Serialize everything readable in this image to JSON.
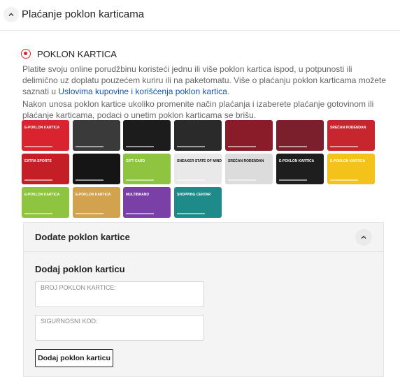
{
  "section": {
    "title": "Plaćanje poklon karticama",
    "toggle_icon": "chevron-up-icon"
  },
  "payment_option": {
    "label": "POKLON KARTICA",
    "selected": true,
    "accent_color": "#e0232d"
  },
  "description": {
    "paragraph1_text": "Platite svoju online porudžbinu koristeći jednu ili više poklon kartica ispod, u potpunosti ili delimično uz doplatu pouzećem kuriru ili na paketomatu. Više o plaćanju poklon karticama možete saznati u ",
    "paragraph1_link": "Uslovima kupovine i korišćenja poklon kartica",
    "paragraph1_end": ".",
    "paragraph2": "Nakon unosa poklon kartice ukoliko promenite način plaćanja i izaberete plaćanje gotovinom ili plaćanje karticama, podaci o unetim poklon karticama se brišu.",
    "link_color": "#1a55a6"
  },
  "gift_cards": [
    {
      "name": "card-e-poklon-red",
      "text": "E-POKLON KARTICA",
      "bg": "#d9232e"
    },
    {
      "name": "card-dark-promo",
      "text": "",
      "bg": "#3a3a3a"
    },
    {
      "name": "card-play-the-game",
      "text": "",
      "bg": "#1c1c1c"
    },
    {
      "name": "card-football",
      "text": "",
      "bg": "#2a2a2a"
    },
    {
      "name": "card-fitness",
      "text": "",
      "bg": "#8a1c2a"
    },
    {
      "name": "card-basketball",
      "text": "",
      "bg": "#7a1f2b"
    },
    {
      "name": "card-srecan-rodjendan-red",
      "text": "SREĆAN ROĐENDAN",
      "bg": "#c8262f"
    },
    {
      "name": "card-extra-sports",
      "text": "EXTRA SPORTS",
      "bg": "#c41f27"
    },
    {
      "name": "card-black-yellow",
      "text": "",
      "bg": "#151515"
    },
    {
      "name": "card-gift-card-green",
      "text": "GIFT CARD",
      "bg": "#8ec43f"
    },
    {
      "name": "card-sneaker-state",
      "text": "SNEAKER STATE OF MIND",
      "bg": "#e9e9e9"
    },
    {
      "name": "card-srecan-rodjendan-bw",
      "text": "SREĆAN ROĐENDAN",
      "bg": "#dcdcdc"
    },
    {
      "name": "card-e-poklon-black",
      "text": "E-POKLON KARTICA",
      "bg": "#1e1e1e"
    },
    {
      "name": "card-e-poklon-yellow",
      "text": "E-POKLON KARTICA",
      "bg": "#f3c21b"
    },
    {
      "name": "card-e-poklon-green",
      "text": "E-POKLON KARTICA",
      "bg": "#8ec43f"
    },
    {
      "name": "card-e-poklon-gold",
      "text": "E-POKLON KARTICA",
      "bg": "#d2a24f"
    },
    {
      "name": "card-multibrand",
      "text": "MULTIBRAND",
      "bg": "#7b3fa8"
    },
    {
      "name": "card-shopping-centar",
      "text": "SHOPPING CENTAR",
      "bg": "#1f8a8a"
    }
  ],
  "panel": {
    "title": "Dodate poklon kartice",
    "collapse_icon": "chevron-up-icon",
    "form_title": "Dodaj poklon karticu",
    "card_number_placeholder": "BROJ POKLON KARTICE:",
    "security_code_placeholder": "SIGURNOSNI KOD:",
    "add_button": "Dodaj poklon karticu"
  }
}
